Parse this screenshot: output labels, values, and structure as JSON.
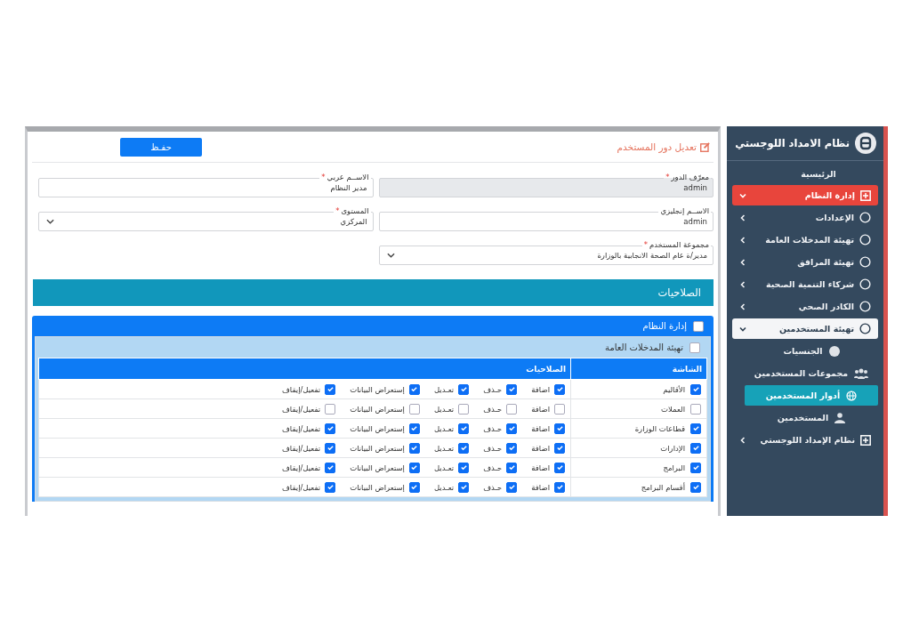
{
  "sidebar": {
    "app_title": "نظام الامداد اللوجستي",
    "items": [
      {
        "kind": "plain",
        "label": "الرئيسية"
      },
      {
        "kind": "group",
        "label": "إدارة النظام",
        "expanded": true,
        "selected": true
      },
      {
        "kind": "menu",
        "label": "الإعدادات",
        "expanded": false,
        "selected": false
      },
      {
        "kind": "menu",
        "label": "تهيئة المدخلات العامة",
        "expanded": false,
        "selected": false
      },
      {
        "kind": "menu",
        "label": "تهيئة المرافق",
        "expanded": false,
        "selected": false
      },
      {
        "kind": "menu",
        "label": "شركاء التنمية الصحية",
        "expanded": false,
        "selected": false
      },
      {
        "kind": "menu",
        "label": "الكادر الصحي",
        "expanded": false,
        "selected": false
      },
      {
        "kind": "menu",
        "label": "تهيئة المستخدمين",
        "expanded": true,
        "selected": true
      },
      {
        "kind": "sub",
        "label": "الجنسيات",
        "selected": false
      },
      {
        "kind": "sub",
        "label": "مجموعات المستخدمين",
        "selected": false
      },
      {
        "kind": "sub",
        "label": "أدوار المستخدمين",
        "selected": true
      },
      {
        "kind": "sub",
        "label": "المستخدمين",
        "selected": false
      },
      {
        "kind": "group",
        "label": "نظام الإمداد اللوجستي",
        "expanded": false,
        "selected": false
      }
    ]
  },
  "form": {
    "title": "تعديل دور المستخدم",
    "save_button": "حفـظ",
    "fields": [
      {
        "kind": "text",
        "label": "معرّف الدور",
        "required_mark": "*",
        "value": "admin",
        "disabled": true
      },
      {
        "kind": "text",
        "label": "الاســم عربي",
        "required_mark": "*",
        "value": "مدير النظام",
        "disabled": false
      },
      {
        "kind": "text",
        "label": "الاســم إنجليزي",
        "value": "admin",
        "disabled": false
      },
      {
        "kind": "select",
        "label": "المستوى",
        "required_mark": "*",
        "value": "المركزي",
        "disabled": false
      },
      {
        "kind": "select",
        "label": "مجموعة المستخدم",
        "required_mark": "*",
        "value": "مدير/ة عام الصحة الانجابية بالوزارة",
        "disabled": false
      }
    ]
  },
  "permissions": {
    "title": "الصلاحيات",
    "section": {
      "label": "إدارة النظام",
      "checked": false
    },
    "subsection": {
      "label": "تهيئة المدخلات العامة",
      "checked": false
    },
    "columns": [
      "الشاشة",
      "الصلاحيات"
    ],
    "rows": [
      {
        "screen": "الأقاليم",
        "checked": true,
        "perms": [
          {
            "label": "اضافة",
            "checked": true
          },
          {
            "label": "حـذف",
            "checked": true
          },
          {
            "label": "تعـديل",
            "checked": true
          },
          {
            "label": "إستعراض البيانات",
            "checked": true
          },
          {
            "label": "تفعيل/إيقاف",
            "checked": true
          }
        ]
      },
      {
        "screen": "العملات",
        "checked": false,
        "perms": [
          {
            "label": "اضافة",
            "checked": false
          },
          {
            "label": "حـذف",
            "checked": false
          },
          {
            "label": "تعـديل",
            "checked": false
          },
          {
            "label": "إستعراض البيانات",
            "checked": false
          },
          {
            "label": "تفعيل/إيقاف",
            "checked": false
          }
        ]
      },
      {
        "screen": "قطاعات الوزارة",
        "checked": true,
        "perms": [
          {
            "label": "اضافة",
            "checked": true
          },
          {
            "label": "حـذف",
            "checked": true
          },
          {
            "label": "تعـديل",
            "checked": true
          },
          {
            "label": "إستعراض البيانات",
            "checked": true
          },
          {
            "label": "تفعيل/إيقاف",
            "checked": true
          }
        ]
      },
      {
        "screen": "الإدارات",
        "checked": true,
        "perms": [
          {
            "label": "اضافة",
            "checked": true
          },
          {
            "label": "حـذف",
            "checked": true
          },
          {
            "label": "تعـديل",
            "checked": true
          },
          {
            "label": "إستعراض البيانات",
            "checked": true
          },
          {
            "label": "تفعيل/إيقاف",
            "checked": true
          }
        ]
      },
      {
        "screen": "البرامج",
        "checked": true,
        "perms": [
          {
            "label": "اضافة",
            "checked": true
          },
          {
            "label": "حـذف",
            "checked": true
          },
          {
            "label": "تعـديل",
            "checked": true
          },
          {
            "label": "إستعراض البيانات",
            "checked": true
          },
          {
            "label": "تفعيل/إيقاف",
            "checked": true
          }
        ]
      },
      {
        "screen": "أقسام البرامج",
        "checked": true,
        "perms": [
          {
            "label": "اضافة",
            "checked": true
          },
          {
            "label": "حـذف",
            "checked": true
          },
          {
            "label": "تعـديل",
            "checked": true
          },
          {
            "label": "إستعراض البيانات",
            "checked": true
          },
          {
            "label": "تفعيل/إيقاف",
            "checked": true
          }
        ]
      }
    ]
  }
}
